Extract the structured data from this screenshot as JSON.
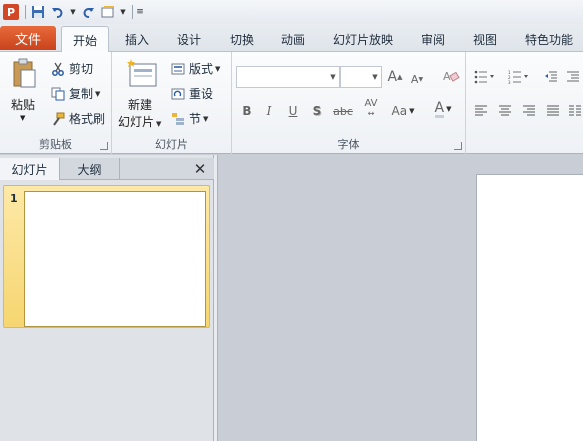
{
  "qat": {
    "app_icon_letter": "P",
    "items": [
      "save-icon",
      "undo-icon",
      "redo-icon",
      "new-slide-icon",
      "customize-icon"
    ]
  },
  "tabs": {
    "file": "文件",
    "items": [
      "开始",
      "插入",
      "设计",
      "切换",
      "动画",
      "幻灯片放映",
      "审阅",
      "视图",
      "特色功能"
    ]
  },
  "clipboard": {
    "paste": "粘贴",
    "cut": "剪切",
    "copy": "复制",
    "format_painter": "格式刷",
    "label": "剪贴板"
  },
  "slides_group": {
    "new_slide_line1": "新建",
    "new_slide_line2": "幻灯片",
    "layout": "版式",
    "reset": "重设",
    "section": "节",
    "label": "幻灯片"
  },
  "font_group": {
    "label": "字体",
    "bold": "B",
    "italic": "I",
    "underline": "U",
    "shadow": "S",
    "strikethrough": "abc",
    "spacing": "AV",
    "case": "Aa",
    "grow": "A",
    "shrink": "A",
    "color": "A"
  },
  "panel": {
    "tab_slides": "幻灯片",
    "tab_outline": "大纲",
    "close": "✕",
    "slide_number": "1"
  },
  "colors": {
    "file_tab": "#d6532a",
    "selected_thumb": "#f6d670"
  }
}
